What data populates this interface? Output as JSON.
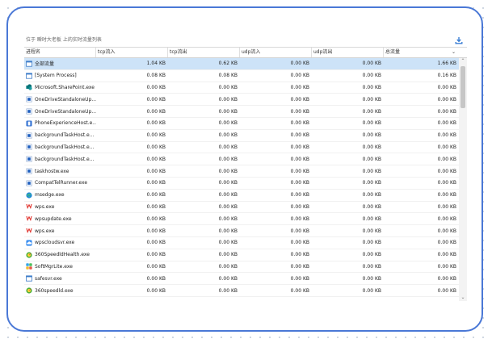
{
  "caption": "位于 瞬时大老板 上的实时流量列表",
  "icons": {
    "export": "download-icon"
  },
  "columns": [
    "进程名",
    "tcp流入",
    "tcp流出",
    "udp流入",
    "udp流出",
    "总流量"
  ],
  "sort_indicator": "⌄",
  "scroll": {
    "up": "⌃",
    "down": "⌄"
  },
  "rows": [
    {
      "name": "全部流量",
      "icon": "window",
      "tcp_in": "1.04 KB",
      "tcp_out": "0.62 KB",
      "udp_in": "0.00 KB",
      "udp_out": "0.00 KB",
      "total": "1.66 KB",
      "selected": true
    },
    {
      "name": "[System Process]",
      "icon": "window",
      "tcp_in": "0.08 KB",
      "tcp_out": "0.08 KB",
      "udp_in": "0.00 KB",
      "udp_out": "0.00 KB",
      "total": "0.16 KB"
    },
    {
      "name": "Microsoft.SharePoint.exe",
      "icon": "sharepoint",
      "tcp_in": "0.00 KB",
      "tcp_out": "0.00 KB",
      "udp_in": "0.00 KB",
      "udp_out": "0.00 KB",
      "total": "0.00 KB"
    },
    {
      "name": "OneDriveStandaloneUp...",
      "icon": "app-blue",
      "tcp_in": "0.00 KB",
      "tcp_out": "0.00 KB",
      "udp_in": "0.00 KB",
      "udp_out": "0.00 KB",
      "total": "0.00 KB"
    },
    {
      "name": "OneDriveStandaloneUp...",
      "icon": "app-blue",
      "tcp_in": "0.00 KB",
      "tcp_out": "0.00 KB",
      "udp_in": "0.00 KB",
      "udp_out": "0.00 KB",
      "total": "0.00 KB"
    },
    {
      "name": "PhoneExperienceHost.e...",
      "icon": "phone",
      "tcp_in": "0.00 KB",
      "tcp_out": "0.00 KB",
      "udp_in": "0.00 KB",
      "udp_out": "0.00 KB",
      "total": "0.00 KB"
    },
    {
      "name": "backgroundTaskHost.e...",
      "icon": "app-blue",
      "tcp_in": "0.00 KB",
      "tcp_out": "0.00 KB",
      "udp_in": "0.00 KB",
      "udp_out": "0.00 KB",
      "total": "0.00 KB"
    },
    {
      "name": "backgroundTaskHost.e...",
      "icon": "app-blue",
      "tcp_in": "0.00 KB",
      "tcp_out": "0.00 KB",
      "udp_in": "0.00 KB",
      "udp_out": "0.00 KB",
      "total": "0.00 KB"
    },
    {
      "name": "backgroundTaskHost.e...",
      "icon": "app-blue",
      "tcp_in": "0.00 KB",
      "tcp_out": "0.00 KB",
      "udp_in": "0.00 KB",
      "udp_out": "0.00 KB",
      "total": "0.00 KB"
    },
    {
      "name": "taskhostw.exe",
      "icon": "app-blue",
      "tcp_in": "0.00 KB",
      "tcp_out": "0.00 KB",
      "udp_in": "0.00 KB",
      "udp_out": "0.00 KB",
      "total": "0.00 KB"
    },
    {
      "name": "CompatTelRunner.exe",
      "icon": "app-blue",
      "tcp_in": "0.00 KB",
      "tcp_out": "0.00 KB",
      "udp_in": "0.00 KB",
      "udp_out": "0.00 KB",
      "total": "0.00 KB"
    },
    {
      "name": "msedge.exe",
      "icon": "edge",
      "tcp_in": "0.00 KB",
      "tcp_out": "0.00 KB",
      "udp_in": "0.00 KB",
      "udp_out": "0.00 KB",
      "total": "0.00 KB"
    },
    {
      "name": "wps.exe",
      "icon": "wps",
      "tcp_in": "0.00 KB",
      "tcp_out": "0.00 KB",
      "udp_in": "0.00 KB",
      "udp_out": "0.00 KB",
      "total": "0.00 KB"
    },
    {
      "name": "wpsupdate.exe",
      "icon": "wps",
      "tcp_in": "0.00 KB",
      "tcp_out": "0.00 KB",
      "udp_in": "0.00 KB",
      "udp_out": "0.00 KB",
      "total": "0.00 KB"
    },
    {
      "name": "wps.exe",
      "icon": "wps",
      "tcp_in": "0.00 KB",
      "tcp_out": "0.00 KB",
      "udp_in": "0.00 KB",
      "udp_out": "0.00 KB",
      "total": "0.00 KB"
    },
    {
      "name": "wpscloudsvr.exe",
      "icon": "cloud",
      "tcp_in": "0.00 KB",
      "tcp_out": "0.00 KB",
      "udp_in": "0.00 KB",
      "udp_out": "0.00 KB",
      "total": "0.00 KB"
    },
    {
      "name": "360SpeedldHealth.exe",
      "icon": "speed360",
      "tcp_in": "0.00 KB",
      "tcp_out": "0.00 KB",
      "udp_in": "0.00 KB",
      "udp_out": "0.00 KB",
      "total": "0.00 KB"
    },
    {
      "name": "SoftMgrLite.exe",
      "icon": "softmgr",
      "tcp_in": "0.00 KB",
      "tcp_out": "0.00 KB",
      "udp_in": "0.00 KB",
      "udp_out": "0.00 KB",
      "total": "0.00 KB"
    },
    {
      "name": "safesvr.exe",
      "icon": "window",
      "tcp_in": "0.00 KB",
      "tcp_out": "0.00 KB",
      "udp_in": "0.00 KB",
      "udp_out": "0.00 KB",
      "total": "0.00 KB"
    },
    {
      "name": "360speedld.exe",
      "icon": "speed360",
      "tcp_in": "0.00 KB",
      "tcp_out": "0.00 KB",
      "udp_in": "0.00 KB",
      "udp_out": "0.00 KB",
      "total": "0.00 KB"
    }
  ],
  "colors": {
    "accent": "#4a78d6",
    "selected_row": "#cde3f8",
    "download_icon": "#3b7fd4"
  }
}
